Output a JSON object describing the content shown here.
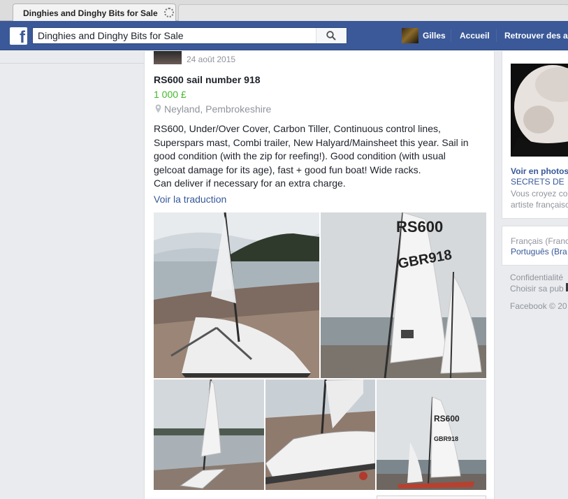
{
  "browser": {
    "tab_title": "Dinghies and Dinghy Bits for Sale",
    "tab_status": "loading"
  },
  "topbar": {
    "logo": "f",
    "search_value": "Dinghies and Dinghy Bits for Sale",
    "search_icon": "search-icon",
    "user_name": "Gilles",
    "home_label": "Accueil",
    "find_friends_label": "Retrouver des a"
  },
  "post": {
    "date": "24 août 2015",
    "title": "RS600 sail number 918",
    "price": "1 000 £",
    "location": "Neyland, Pembrokeshire",
    "description": "RS600, Under/Over Cover, Carbon Tiller, Continuous control lines,\nSuperspars mast, Combi trailer, New Halyard/Mainsheet this year. Sail in\ngood condition (with the zip for reefing!). Good condition (with usual\ngelcoat damage for its age), fast + good fun boat! Wide racks.\nCan deliver if necessary for an extra charge.",
    "translate_link": "Voir la traduction",
    "photos": [
      {
        "sail_number": "",
        "sail_logo": ""
      },
      {
        "sail_number": "GBR918",
        "sail_logo": "RS600"
      },
      {
        "sail_number": "",
        "sail_logo": ""
      },
      {
        "sail_number": "",
        "sail_logo": ""
      },
      {
        "sail_number": "GBR918",
        "sail_logo": "RS600"
      }
    ]
  },
  "sidebar": {
    "ad_title": "Voir en photos",
    "ad_subtitle": "SECRETS DE",
    "ad_text_1": "Vous croyez co",
    "ad_text_2": "artiste françaisc",
    "language_current": "Français (Franc",
    "language_alt": "Português (Bra",
    "footer_privacy": "Confidentialité",
    "footer_ads": "Choisir sa pub",
    "footer_copyright": "Facebook © 20"
  },
  "colors": {
    "facebook_blue": "#3b5998",
    "link_blue": "#365899",
    "price_green": "#42b72a",
    "muted_grey": "#90949c"
  }
}
